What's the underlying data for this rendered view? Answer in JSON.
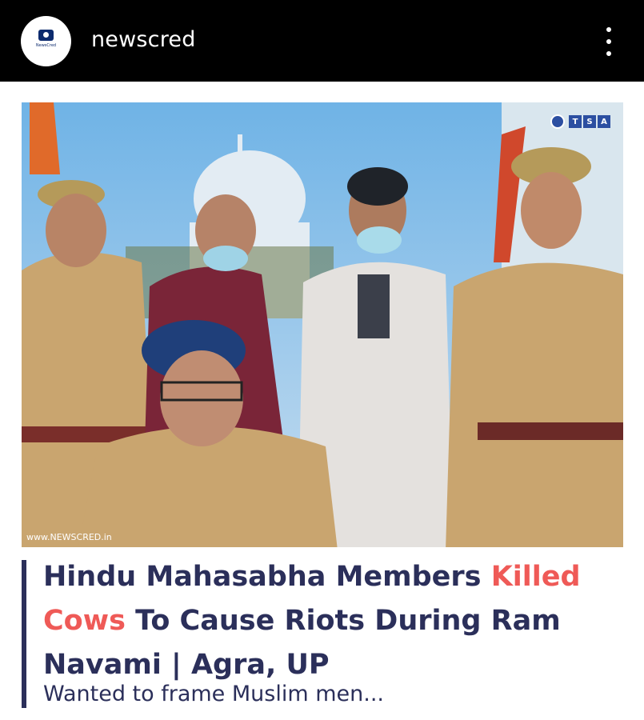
{
  "header": {
    "account_name": "newscred",
    "avatar_text": "NewsCred"
  },
  "post": {
    "image": {
      "badge_letters": [
        "T",
        "S",
        "A"
      ],
      "watermark": "www.NEWSCRED.in"
    },
    "headline": {
      "part1": "Hindu Mahasabha Members ",
      "highlight": "Killed Cows",
      "part2": " To Cause Riots During Ram Navami | Agra, UP"
    },
    "subtitle": "Wanted to frame Muslim men..."
  },
  "colors": {
    "header_bg": "#000000",
    "headline": "#2b2f5a",
    "highlight": "#ef5a57",
    "accent_bar": "#2b2f5a"
  }
}
